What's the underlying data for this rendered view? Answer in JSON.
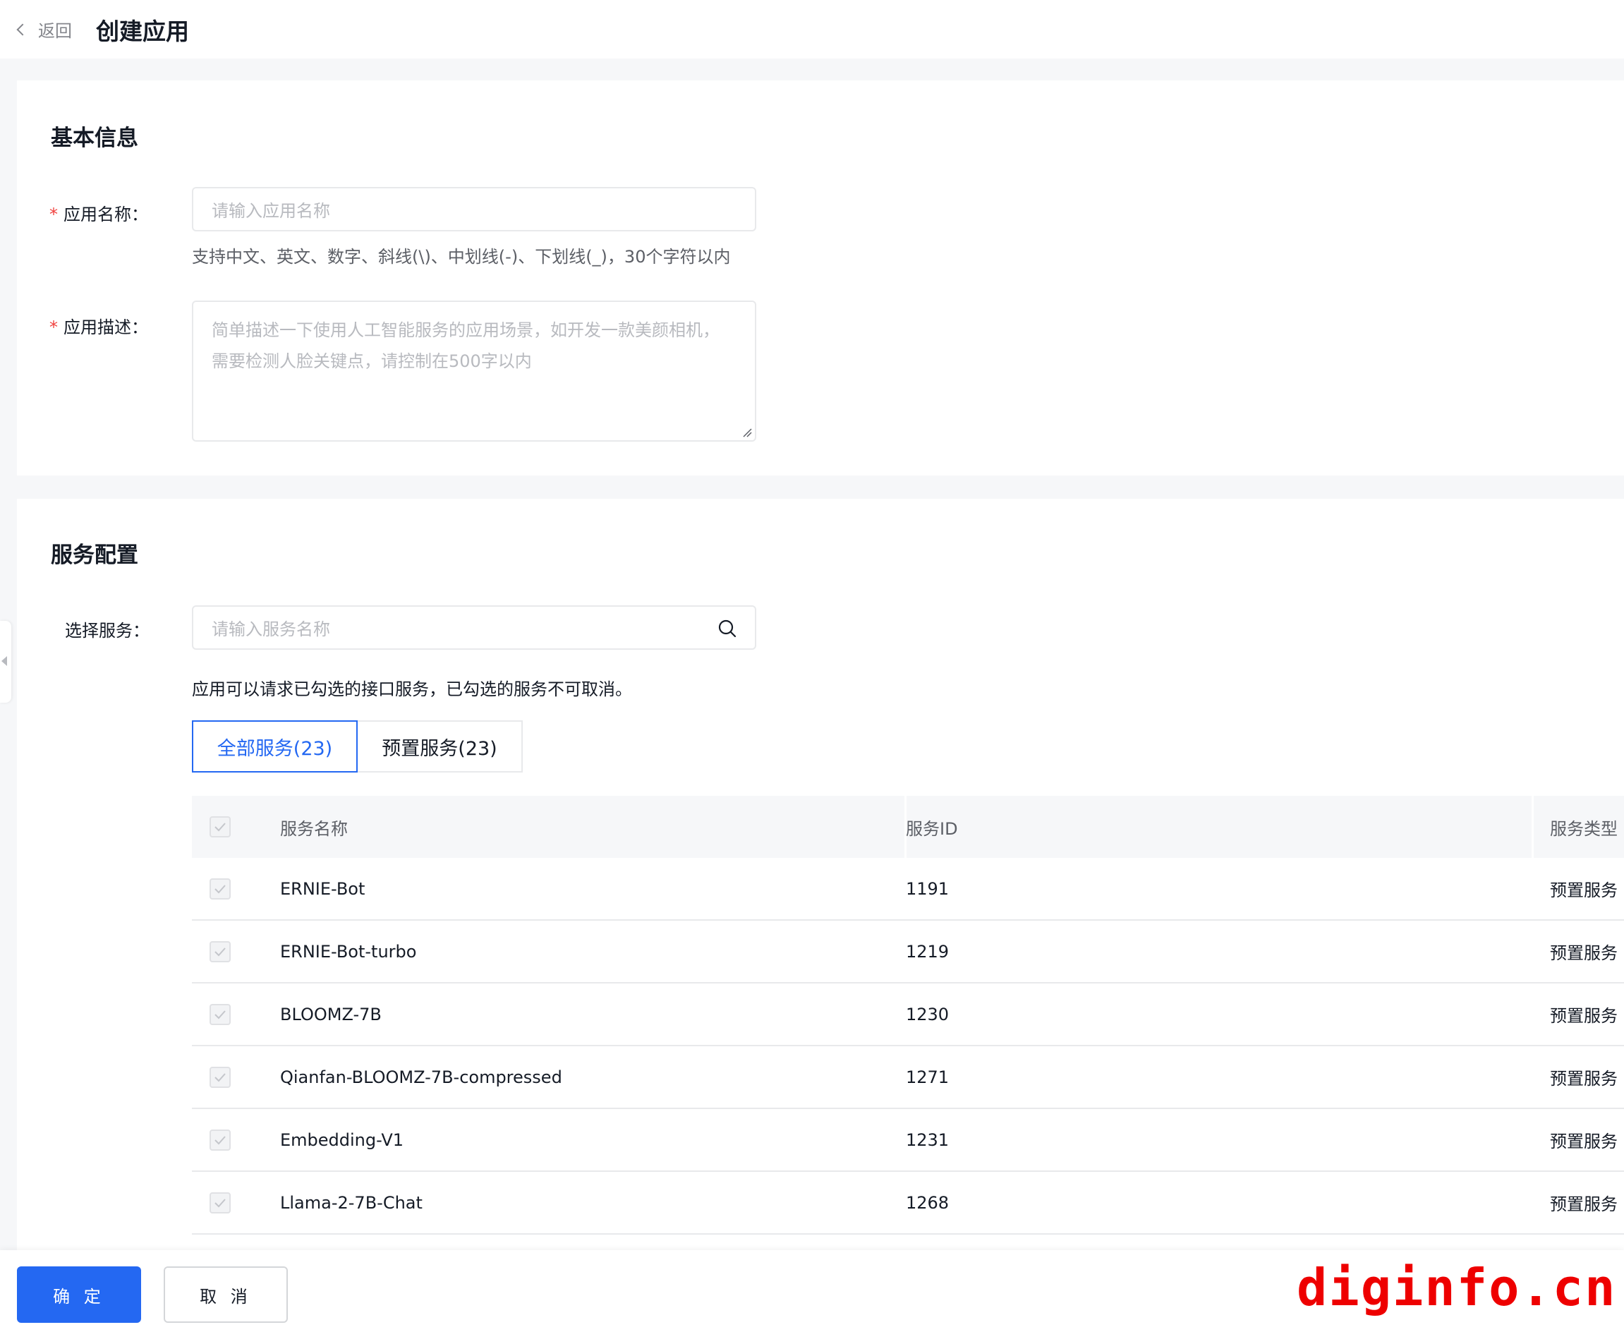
{
  "header": {
    "back_label": "返回",
    "title": "创建应用"
  },
  "basic": {
    "section_title": "基本信息",
    "name": {
      "label": "应用名称：",
      "required_mark": "*",
      "placeholder": "请输入应用名称",
      "hint": "支持中文、英文、数字、斜线(\\)、中划线(-)、下划线(_)，30个字符以内"
    },
    "desc": {
      "label": "应用描述：",
      "required_mark": "*",
      "placeholder_line1": "简单描述一下使用人工智能服务的应用场景，如开发一款美颜相机，",
      "placeholder_line2": "需要检测人脸关键点，请控制在500字以内"
    }
  },
  "service": {
    "section_title": "服务配置",
    "select_label": "选择服务：",
    "search_placeholder": "请输入服务名称",
    "note": "应用可以请求已勾选的接口服务，已勾选的服务不可取消。",
    "tabs": [
      {
        "label": "全部服务(23)",
        "active": true
      },
      {
        "label": "预置服务(23)",
        "active": false
      }
    ],
    "columns": {
      "name": "服务名称",
      "id": "服务ID",
      "type": "服务类型"
    },
    "rows": [
      {
        "name": "ERNIE-Bot",
        "id": "1191",
        "type": "预置服务",
        "checked": true
      },
      {
        "name": "ERNIE-Bot-turbo",
        "id": "1219",
        "type": "预置服务",
        "checked": true
      },
      {
        "name": "BLOOMZ-7B",
        "id": "1230",
        "type": "预置服务",
        "checked": true
      },
      {
        "name": "Qianfan-BLOOMZ-7B-compressed",
        "id": "1271",
        "type": "预置服务",
        "checked": true
      },
      {
        "name": "Embedding-V1",
        "id": "1231",
        "type": "预置服务",
        "checked": true
      },
      {
        "name": "Llama-2-7B-Chat",
        "id": "1268",
        "type": "预置服务",
        "checked": true
      }
    ]
  },
  "footer": {
    "confirm_label": "确 定",
    "cancel_label": "取 消"
  },
  "watermark": "diginfo.cn",
  "colors": {
    "primary": "#2468f2",
    "required": "#f0423f",
    "watermark": "#ee0000"
  }
}
